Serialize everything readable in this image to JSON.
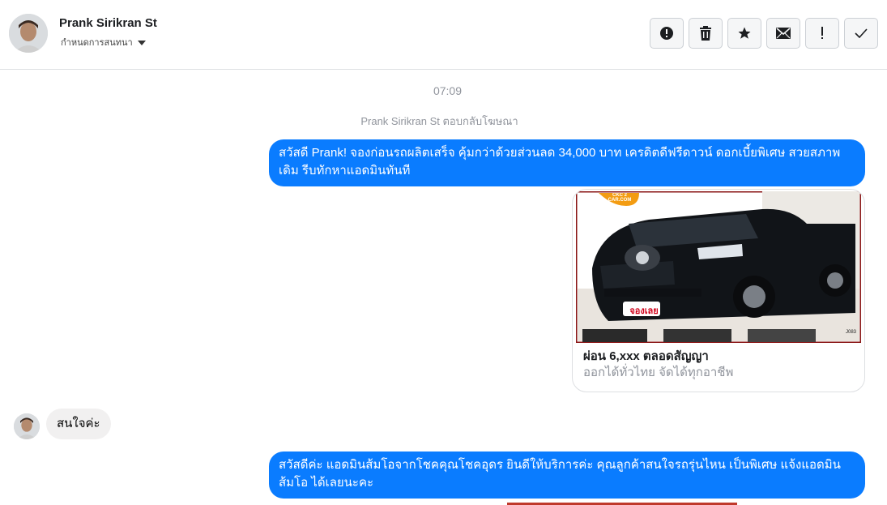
{
  "header": {
    "contact_name": "Prank Sirikran St",
    "conversation_settings_label": "กำหนดการสนทนา"
  },
  "toolbar": {
    "buttons": [
      {
        "icon": "alert-circle-icon",
        "name": "mark-spam-button"
      },
      {
        "icon": "trash-icon",
        "name": "delete-button"
      },
      {
        "icon": "star-icon",
        "name": "star-button"
      },
      {
        "icon": "envelope-icon",
        "name": "mark-unread-button"
      },
      {
        "icon": "exclamation-icon",
        "name": "important-button"
      },
      {
        "icon": "check-icon",
        "name": "mark-done-button"
      }
    ]
  },
  "thread": {
    "timestamp": "07:09",
    "system_message": "Prank Sirikran St ตอบกลับโฆษณา",
    "messages": [
      {
        "direction": "outgoing",
        "text": "สวัสดี Prank! จองก่อนรถผลิตเสร็จ คุ้มกว่าด้วยส่วนลด 34,000 บาท เครดิตดีฟรีดาวน์ ดอกเบี้ยพิเศษ สวยสภาพเดิม รีบทักหาแอดมินทันที"
      },
      {
        "direction": "outgoing",
        "type": "ad_card",
        "title": "ผ่อน 6,xxx ตลอดสัญญา",
        "subtitle": "ออกได้ทั่วไทย จัดได้ทุกอาชีพ",
        "image_badge": "CKC 2 CAR.COM",
        "image_sticker": "จองเลย",
        "image_code": "J083"
      },
      {
        "direction": "incoming",
        "text": "สนใจค่ะ"
      },
      {
        "direction": "outgoing",
        "text": "สวัสดีค่ะ แอดมินส้มโอจากโชคคุณโชคอุดร ยินดีให้บริการค่ะ   คุณลูกค้าสนใจรถรุ่นไหน เป็นพิเศษ แจ้งแอดมินส้มโอ ได้เลยนะคะ"
      }
    ]
  },
  "colors": {
    "outgoing_bubble": "#0a7cff",
    "incoming_bubble": "#f1f0f0",
    "muted_text": "#90949c"
  }
}
